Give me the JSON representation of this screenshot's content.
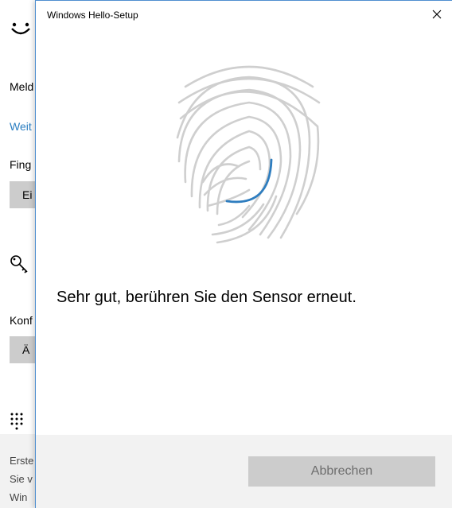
{
  "background": {
    "labels": {
      "meld": "Meld",
      "weit": "Weit",
      "fing": "Fing",
      "konf": "Konf"
    },
    "buttons": {
      "ein": "Ei",
      "ae": "Ä"
    },
    "bottom_text": [
      "Erste",
      "Sie v",
      "Win"
    ],
    "icons": [
      "smiley-icon",
      "key-icon",
      "keypad-icon"
    ]
  },
  "dialog": {
    "title": "Windows Hello-Setup",
    "message": "Sehr gut, berühren Sie den Sensor erneut.",
    "cancel_label": "Abbrechen",
    "progress_fraction": 0.3,
    "colors": {
      "accent": "#2e7dbf",
      "fingerprint_lines": "#cfcfcf",
      "footer": "#f2f2f2",
      "button": "#cccccc",
      "button_text": "#6d6d6d",
      "border": "#4f8fd0"
    }
  }
}
